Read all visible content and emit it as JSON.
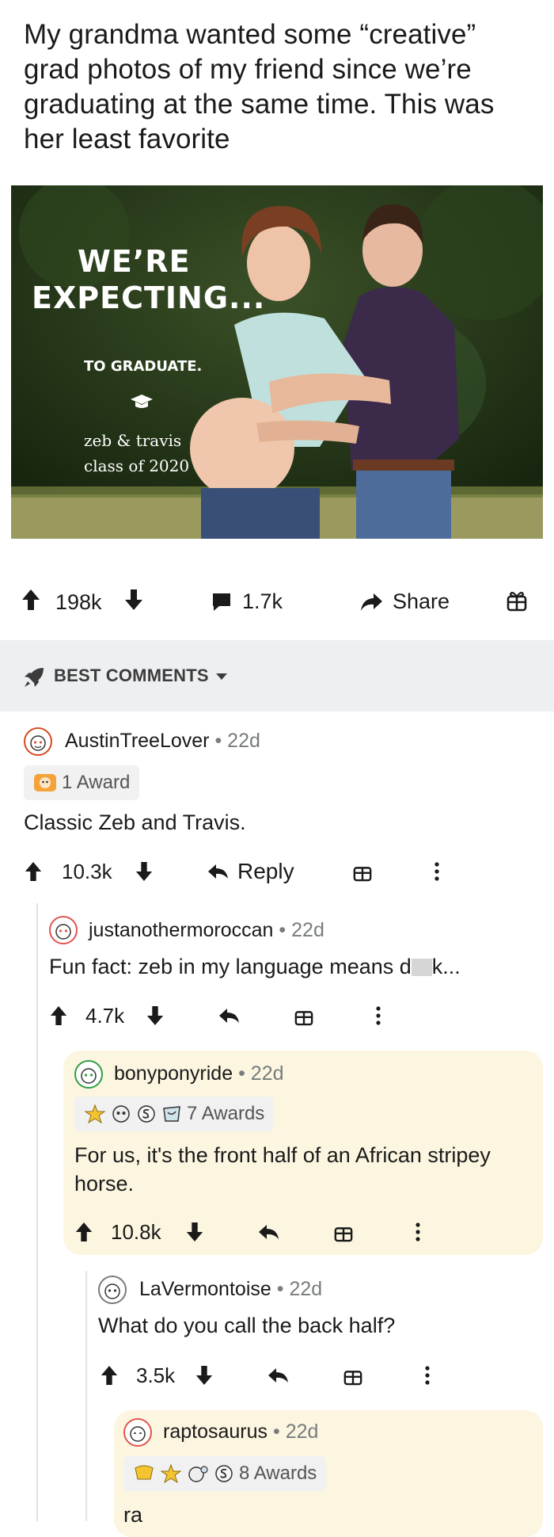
{
  "post": {
    "title": "My grandma wanted some “creative” grad photos of my friend since we’re graduating at the same time. This was her least favorite",
    "image_text": {
      "headline_line1": "WE’RE",
      "headline_line2": "EXPECTING...",
      "subline": "TO GRADUATE.",
      "names": "zeb & travis",
      "class": "class of 2020"
    },
    "upvotes": "198k",
    "comments_count": "1.7k",
    "share_label": "Share"
  },
  "sort": {
    "label": "BEST COMMENTS"
  },
  "comments": [
    {
      "username": "AustinTreeLover",
      "age": "22d",
      "awards": "1 Award",
      "text": "Classic Zeb and Travis.",
      "votes": "10.3k",
      "reply_label": "Reply"
    },
    {
      "username": "justanothermoroccan",
      "age": "22d",
      "text_before": "Fun fact: zeb in my language means d",
      "text_after": "k...",
      "votes": "4.7k"
    },
    {
      "username": "bonyponyride",
      "age": "22d",
      "awards": "7 Awards",
      "text": "For us, it's the front half of an African stripey horse.",
      "votes": "10.8k"
    },
    {
      "username": "LaVermontoise",
      "age": "22d",
      "text": "What do you call the back half?",
      "votes": "3.5k"
    },
    {
      "username": "raptosaurus",
      "age": "22d",
      "awards": "8 Awards",
      "text": "ra"
    }
  ],
  "meta_separator": "•",
  "icons": [
    "upvote-icon",
    "downvote-icon",
    "comment-icon",
    "share-icon",
    "gift-icon",
    "rocket-icon",
    "chevron-down-icon",
    "reply-icon",
    "more-icon"
  ],
  "colors": {
    "section_bg": "#edeff1",
    "highlight_bg": "#fcf6e0",
    "meta_gray": "#787c7e"
  }
}
